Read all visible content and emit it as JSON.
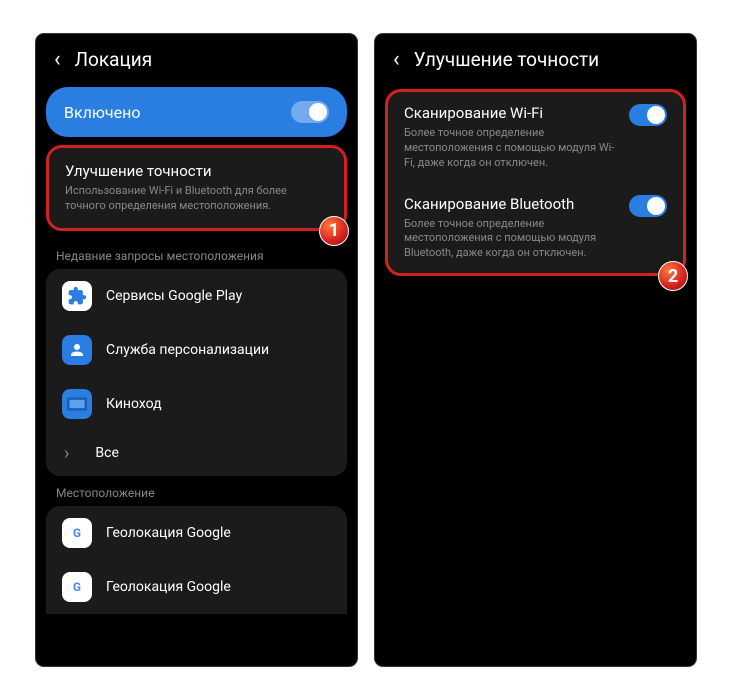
{
  "left": {
    "header_title": "Локация",
    "enabled_label": "Включено",
    "accuracy": {
      "title": "Улучшение точности",
      "desc": "Использование Wi-Fi и Bluetooth для более точного определения местоположения."
    },
    "recent_header": "Недавние запросы местоположения",
    "apps": [
      {
        "label": "Сервисы Google Play"
      },
      {
        "label": "Служба персонализации"
      },
      {
        "label": "Киноход"
      },
      {
        "label": "Все"
      }
    ],
    "location_header": "Местоположение",
    "location_services": [
      {
        "label": "Геолокация Google"
      },
      {
        "label": "Геолокация Google"
      }
    ],
    "badge": "1"
  },
  "right": {
    "header_title": "Улучшение точности",
    "scans": [
      {
        "title": "Сканирование Wi-Fi",
        "desc": "Более точное определение местоположения с помощью модуля Wi-Fi, даже когда он отключен."
      },
      {
        "title": "Сканирование Bluetooth",
        "desc": "Более точное определение местоположения с помощью модуля Bluetooth, даже когда он отключен."
      }
    ],
    "badge": "2"
  }
}
